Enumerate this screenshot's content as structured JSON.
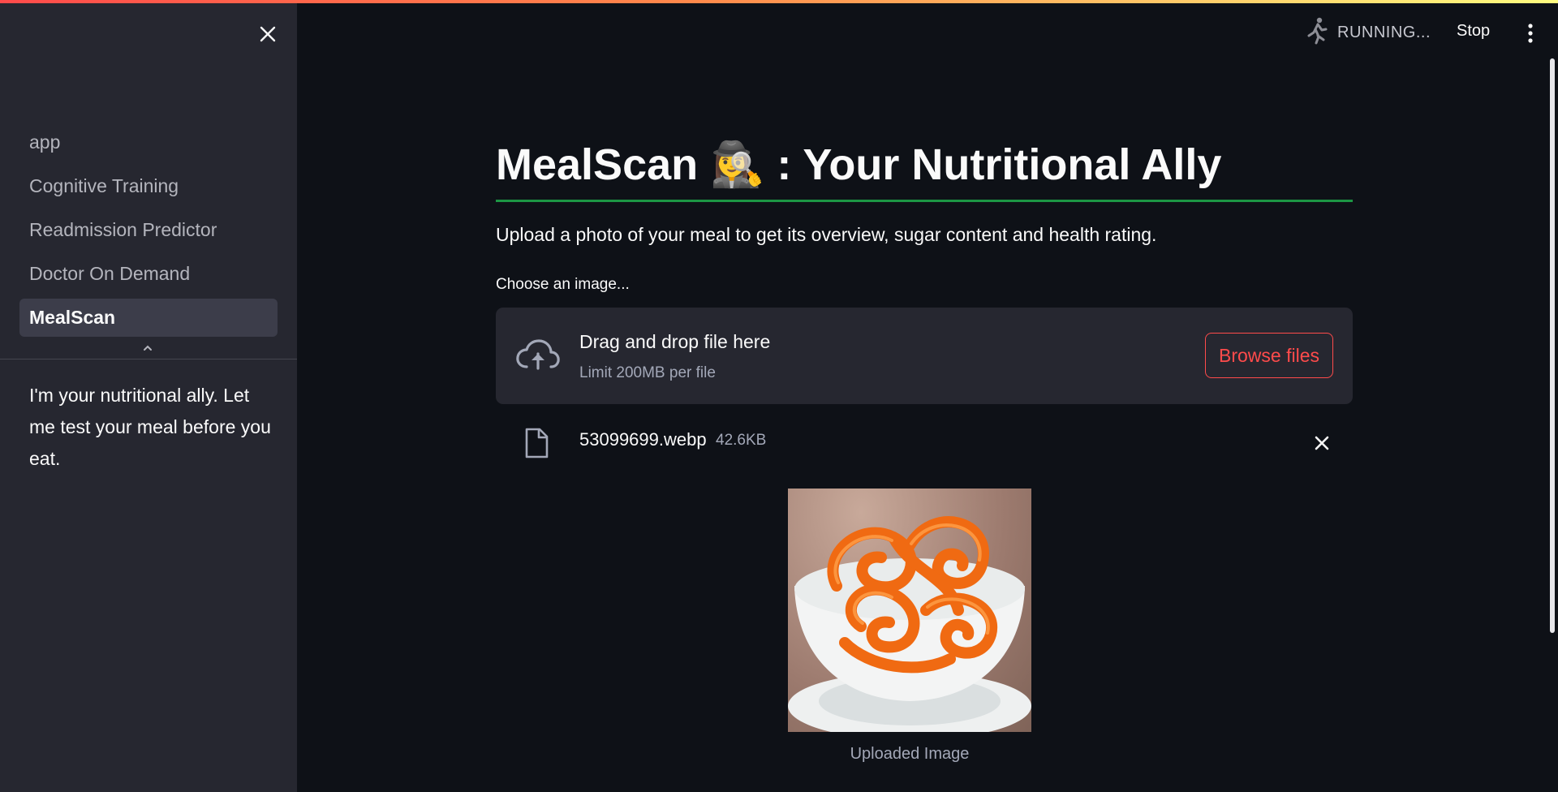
{
  "app": {
    "status_text": "RUNNING...",
    "stop_label": "Stop",
    "colors": {
      "background": "#0e1117",
      "sidebar": "#262730",
      "accent": "#ff4b4b",
      "title_rule": "#21c354"
    }
  },
  "sidebar": {
    "items": [
      {
        "label": "app",
        "active": false
      },
      {
        "label": "Cognitive Training",
        "active": false
      },
      {
        "label": "Readmission Predictor",
        "active": false
      },
      {
        "label": "Doctor On Demand",
        "active": false
      },
      {
        "label": "MealScan",
        "active": true
      }
    ],
    "description": "I'm your nutritional ally. Let me test your meal before you eat."
  },
  "main": {
    "title": "MealScan 🕵️‍♀️ : Your Nutritional Ally",
    "subtitle": "Upload a photo of your meal to get its overview, sugar content and health rating.",
    "uploader": {
      "label": "Choose an image...",
      "drop_text": "Drag and drop file here",
      "limit_text": "Limit 200MB per file",
      "browse_label": "Browse files"
    },
    "file": {
      "name": "53099699.webp",
      "size": "42.6KB"
    },
    "image_caption": "Uploaded Image"
  }
}
